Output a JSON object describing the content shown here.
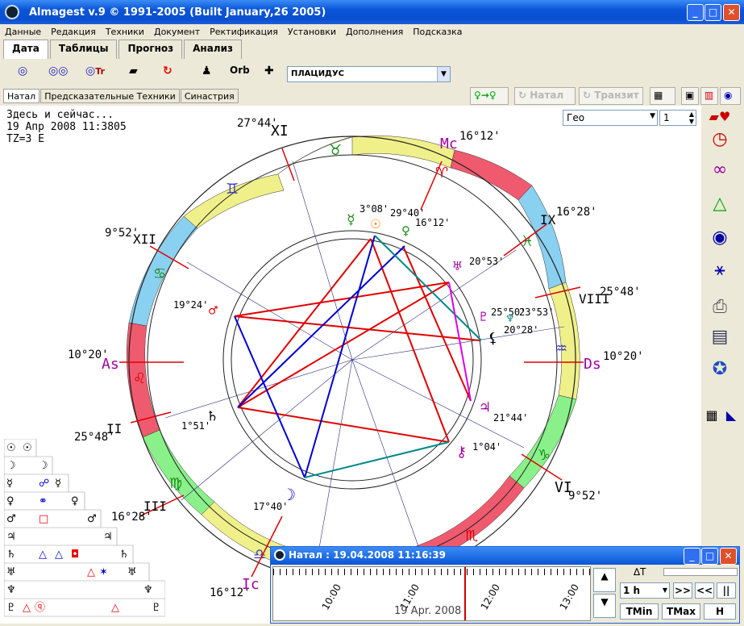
{
  "window": {
    "title": "Almagest v.9 © 1991-2005  (Built January,26 2005)"
  },
  "menu": [
    "Данные",
    "Редакция",
    "Техники",
    "Документ",
    "Ректификация",
    "Установки",
    "Дополнения",
    "Подсказка"
  ],
  "tabs": [
    "Дата",
    "Таблицы",
    "Прогноз",
    "Анализ"
  ],
  "toolbar": {
    "orb_label": "Orb",
    "house_system": "ПЛАЦИДУС"
  },
  "subtabs": [
    "Натал",
    "Предсказательные Техники",
    "Синастрия"
  ],
  "right_buttons": {
    "natal": "Натал",
    "transit": "Транзит"
  },
  "info": {
    "line1": "Здесь и сейчас...",
    "line2": "19 Апр 2008 11:3805",
    "line3": "TZ=3 E"
  },
  "geo": {
    "mode": "Гео",
    "count": "1"
  },
  "houses": [
    {
      "num": "XI",
      "deg": "27°44'"
    },
    {
      "num": "XII",
      "deg": "9°52'"
    },
    {
      "num": "As",
      "deg": "10°20'"
    },
    {
      "num": "II",
      "deg": "25°48'"
    },
    {
      "num": "III",
      "deg": "16°28'"
    },
    {
      "num": "Ic",
      "deg": "16°12'"
    },
    {
      "num": "Mc",
      "deg": "16°12'"
    },
    {
      "num": "IX",
      "deg": "16°28'"
    },
    {
      "num": "VIII",
      "deg": "25°48'"
    },
    {
      "num": "Ds",
      "deg": "10°20'"
    },
    {
      "num": "VI",
      "deg": "9°52'"
    }
  ],
  "planets": [
    {
      "name": "mercury",
      "deg": "3°08'"
    },
    {
      "name": "sun",
      "deg": "29°40'"
    },
    {
      "name": "venus",
      "deg": "16°12'"
    },
    {
      "name": "uranus",
      "deg": "20°53'"
    },
    {
      "name": "pluto",
      "deg": "25°50'"
    },
    {
      "name": "neptune",
      "deg": "23°53'"
    },
    {
      "name": "lilith",
      "deg": "20°28'"
    },
    {
      "name": "jupiter",
      "deg": "21°44'"
    },
    {
      "name": "chiron",
      "deg": "1°04'"
    },
    {
      "name": "mars",
      "deg": "19°24'"
    },
    {
      "name": "saturn",
      "deg": "1°51'"
    },
    {
      "name": "moon",
      "deg": "17°40'"
    }
  ],
  "timewindow": {
    "title": "Натал : 19.04.2008  11:16:39",
    "date": "19 Apr. 2008",
    "ticks": [
      "10:00",
      "11:00",
      "12:00",
      "13:00"
    ],
    "step": "1 h",
    "delta": "∆T",
    "tmin": "TMin",
    "tmax": "TMax",
    "h": "H"
  },
  "colors": {
    "fire": "#f05a6e",
    "earth": "#f0f08a",
    "air": "#8ad0f0",
    "water": "#8af08a",
    "aspect_red": "#e00000",
    "aspect_blue": "#0000d0",
    "aspect_green": "#008888"
  }
}
